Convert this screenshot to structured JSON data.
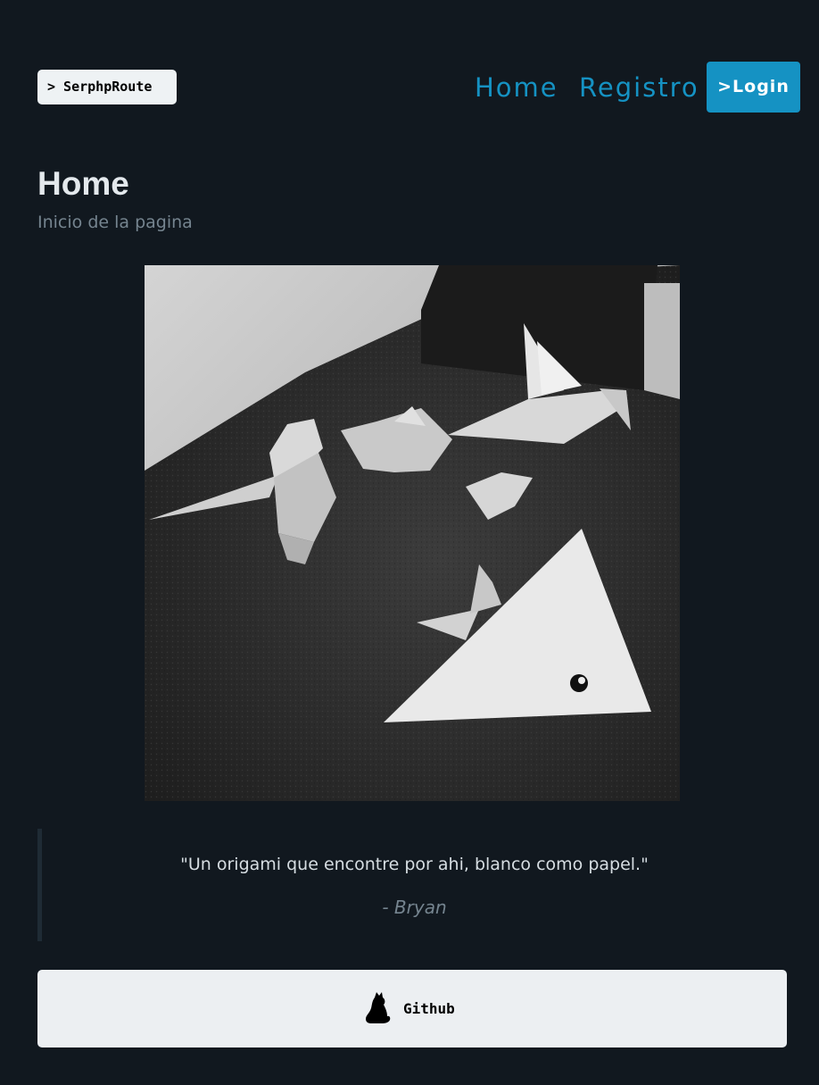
{
  "header": {
    "brand_label": "> SerphpRoute",
    "nav": {
      "home_label": "Home",
      "registro_label": "Registro",
      "login_label": ">Login"
    }
  },
  "main": {
    "title": "Home",
    "subtitle": "Inicio de la pagina",
    "image": {
      "icon": "origami-photo"
    },
    "quote": {
      "text": "\"Un origami que encontre por ahi, blanco como papel.\"",
      "author": "- Bryan"
    },
    "github_button": {
      "icon": "cat-icon",
      "label": "Github"
    }
  },
  "colors": {
    "background": "#11181f",
    "accent": "#1592c3",
    "title": "#e3e8ec",
    "muted": "#75848f",
    "button_light": "#eceff2"
  }
}
